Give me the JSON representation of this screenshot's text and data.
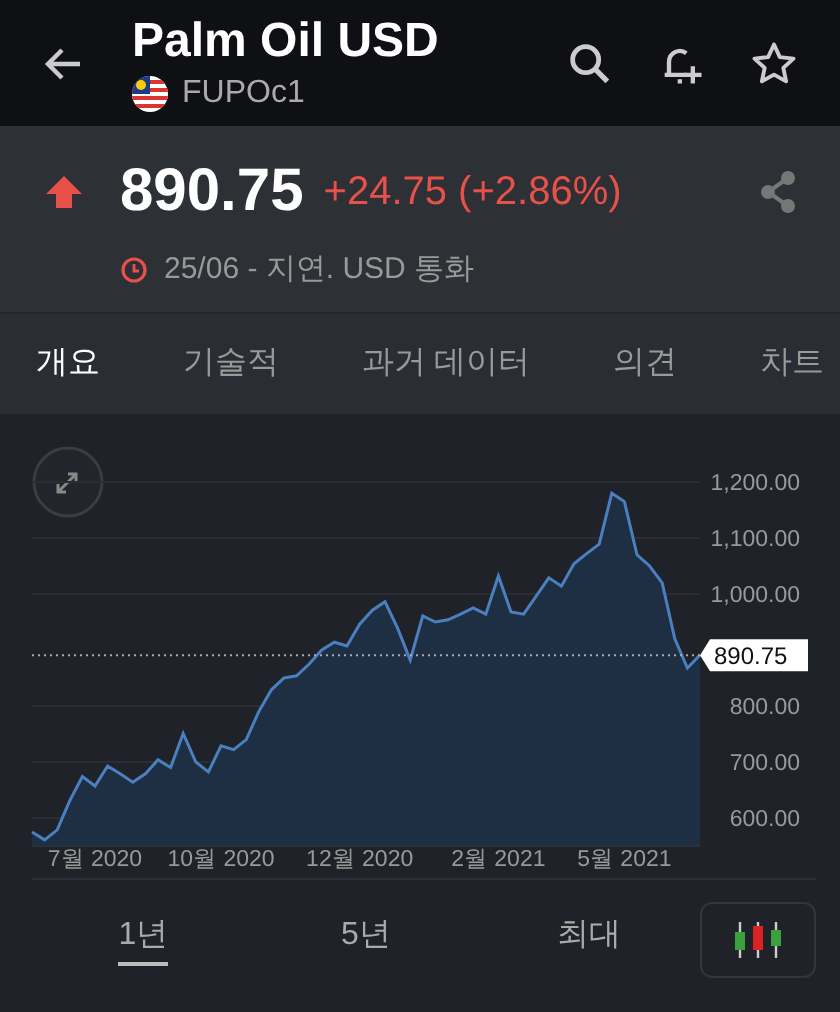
{
  "header": {
    "title": "Palm Oil USD",
    "symbol": "FUPOc1"
  },
  "quote": {
    "price": "890.75",
    "change": "+24.75 (+2.86%)",
    "note": "25/06 - 지연. USD 통화"
  },
  "tabs": [
    {
      "label": "개요",
      "selected": true
    },
    {
      "label": "기술적",
      "selected": false
    },
    {
      "label": "과거 데이터",
      "selected": false
    },
    {
      "label": "의견",
      "selected": false
    },
    {
      "label": "차트",
      "selected": false
    }
  ],
  "chart_data": {
    "type": "area",
    "grid": true,
    "categories": [
      null,
      null,
      null,
      null,
      null,
      "7월 2020",
      null,
      null,
      null,
      null,
      null,
      null,
      null,
      null,
      null,
      "10월 2020",
      null,
      null,
      null,
      null,
      null,
      null,
      null,
      null,
      null,
      null,
      "12월 2020",
      null,
      null,
      null,
      null,
      null,
      null,
      null,
      null,
      null,
      null,
      "2월 2021",
      null,
      null,
      null,
      null,
      null,
      null,
      null,
      null,
      null,
      "5월 2021",
      null,
      null,
      null,
      null,
      null,
      null
    ],
    "values": [
      575,
      561,
      579,
      631,
      674,
      657,
      693,
      679,
      664,
      679,
      704,
      690,
      751,
      700,
      682,
      729,
      722,
      740,
      790,
      829,
      850,
      854,
      875,
      900,
      914,
      907,
      946,
      971,
      986,
      939,
      882,
      961,
      950,
      954,
      964,
      975,
      964,
      1032,
      968,
      964,
      996,
      1029,
      1014,
      1054,
      1072,
      1089,
      1180,
      1165,
      1070,
      1050,
      1020,
      920,
      868,
      891
    ],
    "yticks": [
      {
        "value": 600,
        "label": "600.00"
      },
      {
        "value": 700,
        "label": "700.00"
      },
      {
        "value": 800,
        "label": "800.00"
      },
      {
        "value": 1000,
        "label": "1,000.00"
      },
      {
        "value": 1100,
        "label": "1,100.00"
      },
      {
        "value": 1200,
        "label": "1,200.00"
      }
    ],
    "ylim": [
      550,
      1200
    ],
    "ref_lines": [
      {
        "axis": "y",
        "value": 890.75,
        "label": "890.75"
      }
    ]
  },
  "ranges": [
    {
      "label": "1년",
      "selected": true
    },
    {
      "label": "5년",
      "selected": false
    },
    {
      "label": "최대",
      "selected": false
    }
  ]
}
